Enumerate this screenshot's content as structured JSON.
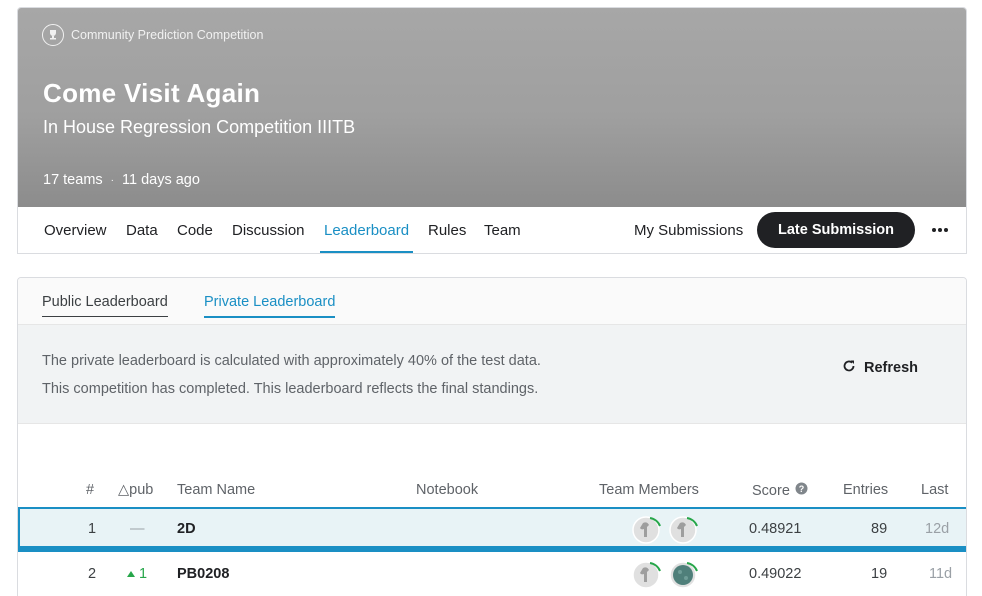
{
  "competition": {
    "type_label": "Community Prediction Competition",
    "title": "Come Visit Again",
    "subtitle": "In House Regression Competition IIITB",
    "teams": "17 teams",
    "separator": "·",
    "time_ago": "11 days ago",
    "icon": "trophy-icon"
  },
  "nav": {
    "tabs": [
      {
        "label": "Overview",
        "active": false
      },
      {
        "label": "Data",
        "active": false
      },
      {
        "label": "Code",
        "active": false
      },
      {
        "label": "Discussion",
        "active": false
      },
      {
        "label": "Leaderboard",
        "active": true
      },
      {
        "label": "Rules",
        "active": false
      },
      {
        "label": "Team",
        "active": false
      }
    ],
    "my_submissions": "My Submissions",
    "late_submission": "Late Submission",
    "more_icon": "more-horizontal-icon"
  },
  "leaderboard": {
    "tabs": [
      {
        "label": "Public Leaderboard",
        "active": false
      },
      {
        "label": "Private Leaderboard",
        "active": true
      }
    ],
    "info_line1": "The private leaderboard is calculated with approximately 40% of the test data.",
    "info_line2": "This competition has completed. This leaderboard reflects the final standings.",
    "refresh_label": "Refresh",
    "refresh_icon": "refresh-icon",
    "columns": {
      "rank": "#",
      "delta": "△pub",
      "team_name": "Team Name",
      "notebook": "Notebook",
      "team_members": "Team Members",
      "score": "Score",
      "entries": "Entries",
      "last": "Last"
    },
    "rows": [
      {
        "rank": "1",
        "delta": "—",
        "team": "2D",
        "score": "0.48921",
        "entries": "89",
        "last": "12d",
        "highlighted": true
      },
      {
        "rank": "2",
        "delta": "1",
        "team": "PB0208",
        "score": "0.49022",
        "entries": "19",
        "last": "11d",
        "highlighted": false
      }
    ]
  },
  "colors": {
    "accent": "#1a8fc4",
    "banner": "#9f9f9f",
    "positive": "#27a64a",
    "highlight_bg": "#e8f3f6"
  }
}
